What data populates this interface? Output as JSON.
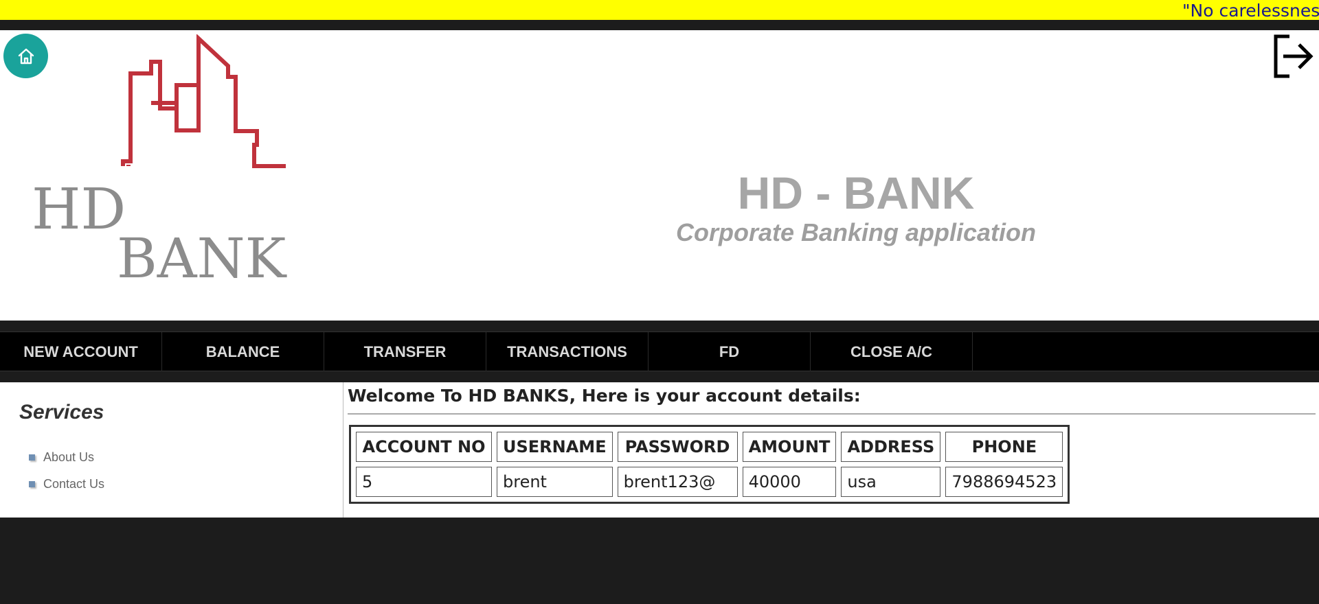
{
  "marquee": {
    "text": "\"No carelessness"
  },
  "header": {
    "logo_text_line1": "HD",
    "logo_text_line2": "BANK",
    "title": "HD - BANK",
    "subtitle": "Corporate Banking application",
    "home_icon": "home-icon",
    "logout_icon": "logout-icon"
  },
  "nav": {
    "items": [
      {
        "label": "NEW ACCOUNT"
      },
      {
        "label": "BALANCE"
      },
      {
        "label": "TRANSFER"
      },
      {
        "label": "TRANSACTIONS"
      },
      {
        "label": "FD"
      },
      {
        "label": "CLOSE A/C"
      }
    ]
  },
  "sidebar": {
    "title": "Services",
    "links": [
      {
        "label": "About Us"
      },
      {
        "label": "Contact Us"
      }
    ]
  },
  "main": {
    "welcome": "Welcome To HD BANKS, Here is your account details:",
    "table": {
      "headers": [
        "ACCOUNT NO",
        "USERNAME",
        "PASSWORD",
        "AMOUNT",
        "ADDRESS",
        "PHONE"
      ],
      "rows": [
        [
          "5",
          "brent",
          "brent123@",
          "40000",
          "usa",
          "7988694523"
        ]
      ]
    }
  },
  "colors": {
    "marquee_bg": "#ffff00",
    "home_button": "#1aa39b",
    "logo_red": "#c0323c",
    "nav_bg": "#000000"
  }
}
